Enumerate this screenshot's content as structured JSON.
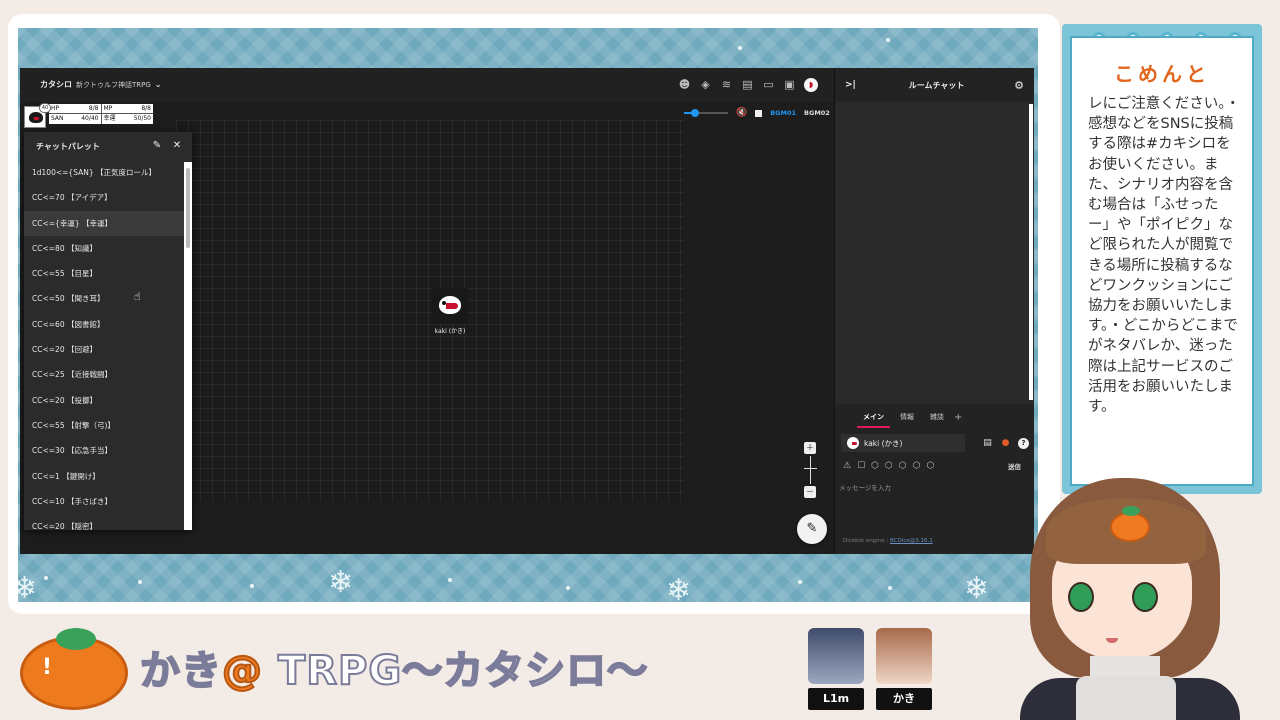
{
  "app": {
    "room_title": "カタシロ",
    "room_subtitle": "新クトゥルフ神話TRPG",
    "toolbar_icons": [
      "avatar-icon",
      "layers-icon",
      "stack-icon",
      "note-icon",
      "screen-icon",
      "image-icon",
      "user-avatar-icon"
    ],
    "bgm": {
      "volume_fraction": 0.26,
      "track1": "BGM01",
      "track2": "BGM02"
    },
    "accent_color": "#2196f3",
    "character": {
      "level_badge": "40",
      "hp_label": "HP",
      "hp_value": "8/8",
      "mp_label": "MP",
      "mp_value": "8/8",
      "san_label": "SAN",
      "san_value": "40/40",
      "luck_label": "幸運",
      "luck_value": "50/50"
    },
    "token_label": "kaki (かき)",
    "chat_palette": {
      "title": "チャットパレット",
      "items": [
        "1d100<={SAN} 【正気度ロール】",
        "CC<=70 【アイデア】",
        "CC<={幸運} 【幸運】",
        "CC<=80 【知識】",
        "CC<=55 【目星】",
        "CC<=50 【聞き耳】",
        "CC<=60 【図書館】",
        "CC<=20 【回避】",
        "CC<=25 【近接戦闘】",
        "CC<=20 【投擲】",
        "CC<=55 【射撃（弓)】",
        "CC<=30 【応急手当】",
        "CC<=1 【鍵開け】",
        "CC<=10 【手さばき】",
        "CC<=20 【隠密】"
      ]
    },
    "chat": {
      "title": "ルームチャット",
      "tabs": [
        "メイン",
        "情報",
        "雑談"
      ],
      "active_tab_color": "#e0195f",
      "sender": "kaki (かき)",
      "send_label": "送信",
      "input_placeholder": "メッセージを入力",
      "footer_text": "Dicebot engine : ",
      "footer_link": "BCDice@3.16.1"
    }
  },
  "comment": {
    "title": "こめんと",
    "text": "レにご注意ください。・感想などをSNSに投稿する際は#カキシロをお使いください。また、シナリオ内容を含む場合は「ふせったー」や「ポイピク」など限られた人が閲覧できる場所に投稿するなどワンクッションにご協力をお願いいたします。・どこからどこまでがネタバレか、迷った際は上記サービスのご活用をお願いいたします。"
  },
  "banner": {
    "name": "かき",
    "at": "@",
    "title": "TRPG〜カタシロ〜",
    "title_color": "#ffffff",
    "at_color": "#ef7a22"
  },
  "players": [
    {
      "tag": "L1m",
      "color": "#5b6b8c"
    },
    {
      "tag": "かき",
      "color": "#d9b7a0"
    }
  ]
}
